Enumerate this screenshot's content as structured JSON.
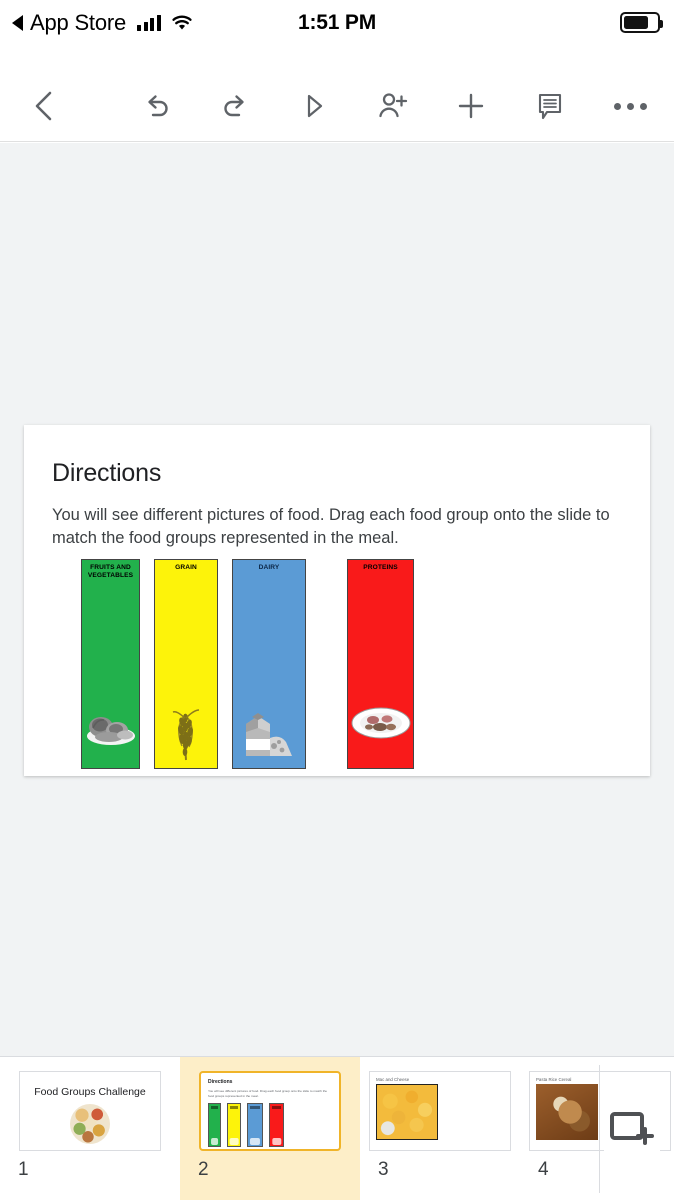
{
  "status_bar": {
    "back_app": "App Store",
    "back_icon": "back-triangle-icon",
    "signal_icon": "cellular-signal-icon",
    "wifi_icon": "wifi-icon",
    "time": "1:51 PM",
    "battery_icon": "battery-icon"
  },
  "toolbar": {
    "items": [
      {
        "name": "back-button",
        "icon": "chevron-left-icon"
      },
      {
        "name": "undo-button",
        "icon": "undo-arrow-icon"
      },
      {
        "name": "redo-button",
        "icon": "redo-arrow-icon"
      },
      {
        "name": "present-button",
        "icon": "play-triangle-icon"
      },
      {
        "name": "share-button",
        "icon": "person-add-icon"
      },
      {
        "name": "add-button",
        "icon": "plus-icon"
      },
      {
        "name": "comments-button",
        "icon": "comment-lines-icon"
      },
      {
        "name": "more-options-button",
        "icon": "more-horizontal-icon"
      }
    ]
  },
  "slide": {
    "title": "Directions",
    "body": "You will see different pictures of food. Drag each food group onto the slide to match the food groups represented in the meal.",
    "cards": [
      {
        "label": "FRUITS AND VEGETABLES",
        "color": "#22b14c",
        "text_color": "#000000",
        "image": "vegetables-image"
      },
      {
        "label": "GRAIN",
        "color": "#fdf30a",
        "text_color": "#000000",
        "image": "wheat-stalk-image"
      },
      {
        "label": "DAIRY",
        "color": "#5b9bd5",
        "text_color": "#0b2545",
        "image": "milk-carton-cheese-image"
      },
      {
        "label": "PROTEINS",
        "color": "#f91a1a",
        "text_color": "#000000",
        "image": "plate-of-protein-image"
      }
    ]
  },
  "filmstrip": {
    "slides": [
      {
        "number": "1",
        "title": "Food Groups Challenge",
        "selected": false
      },
      {
        "number": "2",
        "title": "Directions",
        "body": "You will see different pictures of food. Drag each food group onto the slide to match the food groups represented in the meal.",
        "selected": true
      },
      {
        "number": "3",
        "title": "Mac and Cheese",
        "selected": false
      },
      {
        "number": "4",
        "title": "Pasta Rice Cereal",
        "selected": false
      }
    ],
    "add_slide_icon": "add-slide-icon"
  },
  "colors": {
    "canvas_background": "#f1f3f4",
    "toolbar_icon": "#5f6368",
    "selected_thumb_background": "#fdeec8",
    "selected_thumb_border": "#f0b429"
  }
}
